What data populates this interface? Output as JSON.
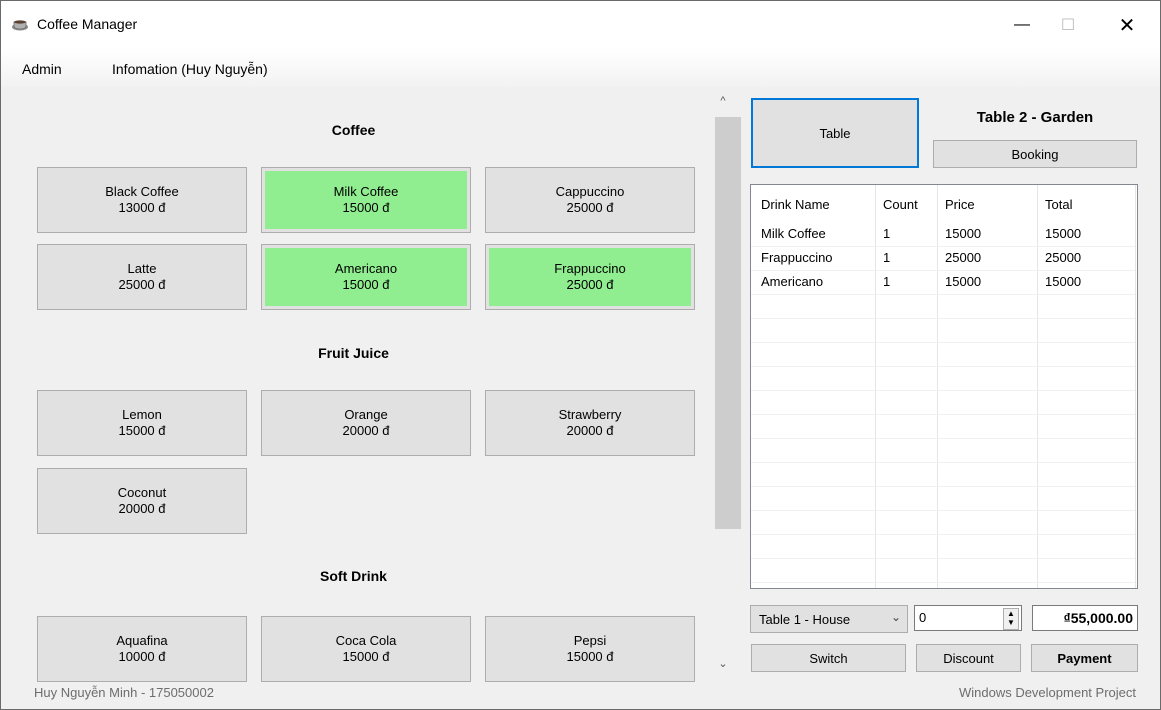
{
  "window": {
    "title": "Coffee Manager",
    "app_icon": "coffee-cup-icon",
    "min_label": "—",
    "max_label": "☐",
    "close_label": "✕"
  },
  "menu": {
    "admin": "Admin",
    "info": "Infomation (Huy Nguyễn)"
  },
  "categories": {
    "coffee": "Coffee",
    "fruit_juice": "Fruit Juice",
    "soft_drink": "Soft Drink"
  },
  "drinks": {
    "black_coffee": {
      "name": "Black Coffee",
      "price": "13000 đ"
    },
    "milk_coffee": {
      "name": "Milk Coffee",
      "price": "15000 đ"
    },
    "cappuccino": {
      "name": "Cappuccino",
      "price": "25000 đ"
    },
    "latte": {
      "name": "Latte",
      "price": "25000 đ"
    },
    "americano": {
      "name": "Americano",
      "price": "15000 đ"
    },
    "frappuccino": {
      "name": "Frappuccino",
      "price": "25000 đ"
    },
    "lemon": {
      "name": "Lemon",
      "price": "15000 đ"
    },
    "orange": {
      "name": "Orange",
      "price": "20000 đ"
    },
    "strawberry": {
      "name": "Strawberry",
      "price": "20000 đ"
    },
    "coconut": {
      "name": "Coconut",
      "price": "20000 đ"
    },
    "aquafina": {
      "name": "Aquafina",
      "price": "10000 đ"
    },
    "coca_cola": {
      "name": "Coca Cola",
      "price": "15000 đ"
    },
    "pepsi": {
      "name": "Pepsi",
      "price": "15000 đ"
    }
  },
  "selected_color": "#90ee90",
  "right": {
    "table_button": "Table",
    "table_label": "Table 2 - Garden",
    "booking_button": "Booking"
  },
  "order_grid": {
    "headers": [
      "Drink Name",
      "Count",
      "Price",
      "Total"
    ],
    "rows": [
      [
        "Milk Coffee",
        "1",
        "15000",
        "15000"
      ],
      [
        "Frappuccino",
        "1",
        "25000",
        "25000"
      ],
      [
        "Americano",
        "1",
        "15000",
        "15000"
      ]
    ]
  },
  "controls": {
    "table_select": "Table 1 - House",
    "discount_value": "0",
    "total": "₫55,000.00",
    "switch": "Switch",
    "discount": "Discount",
    "payment": "Payment"
  },
  "footer": {
    "left": "Huy Nguyễn Minh - 175050002",
    "right": "Windows Development Project"
  }
}
